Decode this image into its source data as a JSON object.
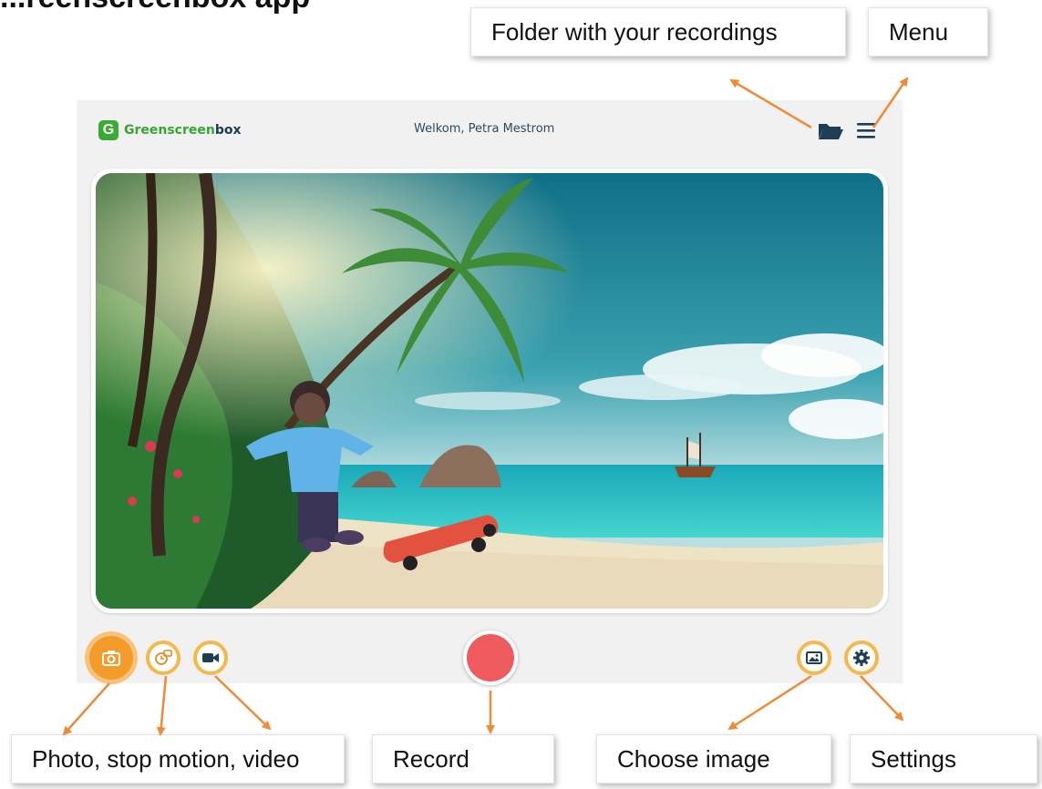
{
  "page_heading_partial": "...reenscreenbox app",
  "callouts": {
    "folder": "Folder with your recordings",
    "menu": "Menu",
    "modes": "Photo, stop motion, video",
    "record": "Record",
    "choose_image": "Choose image",
    "settings": "Settings"
  },
  "app": {
    "logo_letter": "G",
    "logo_name_1": "Greenscreen",
    "logo_name_2": "box",
    "welcome": "Welkom, Petra Mestrom"
  },
  "colors": {
    "accent": "#f39c2b",
    "brand_green": "#3aaa35",
    "record_red": "#ef5b5f",
    "arrow": "#ee8b37"
  },
  "icons": {
    "folder": "folder-open-icon",
    "menu": "hamburger-icon",
    "photo": "camera-icon",
    "stop_motion": "stop-motion-icon",
    "video": "video-camera-icon",
    "image": "image-icon",
    "settings": "gear-icon"
  }
}
